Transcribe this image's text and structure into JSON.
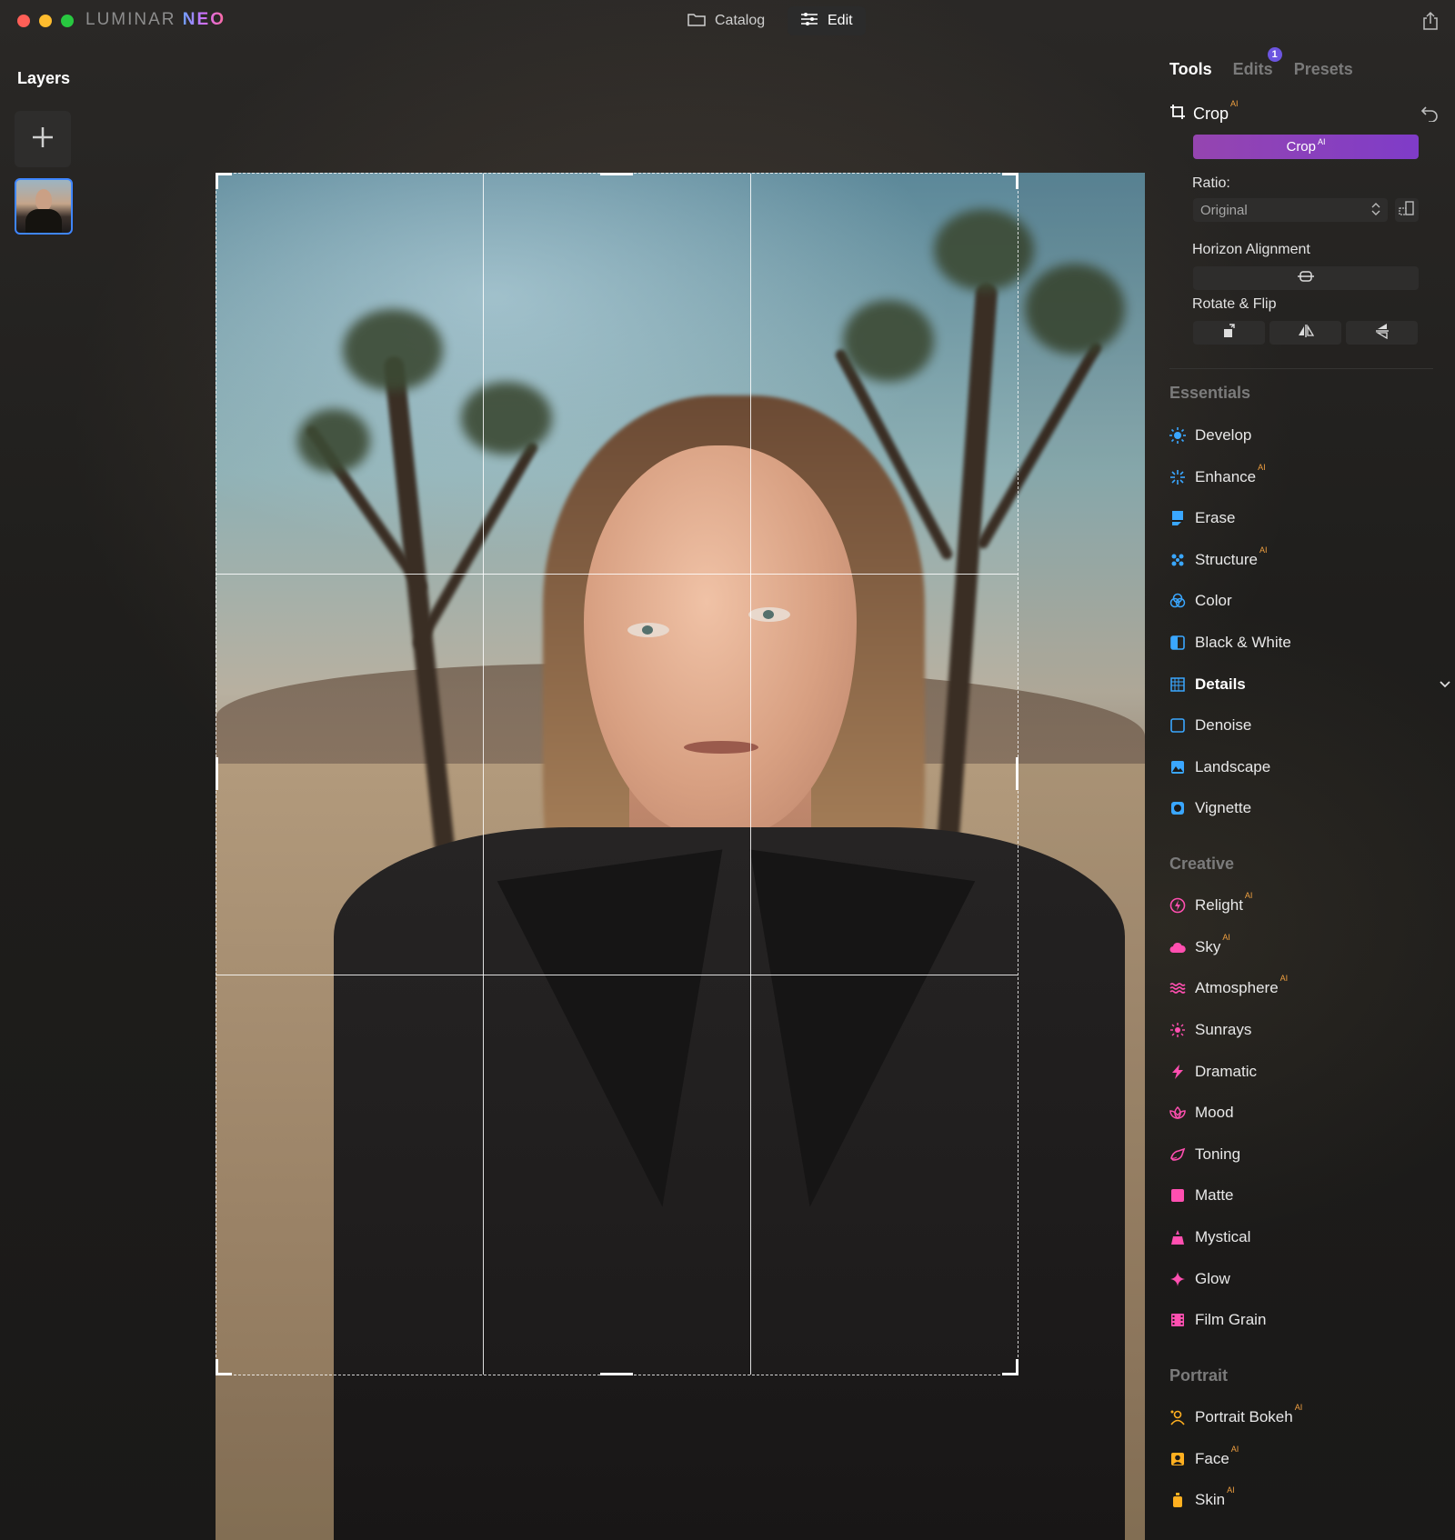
{
  "app": {
    "brand_part1": "LUMINAR",
    "brand_part2": "NEO"
  },
  "topbar": {
    "catalog_label": "Catalog",
    "edit_label": "Edit"
  },
  "layers": {
    "title": "Layers"
  },
  "right_panel": {
    "tabs": [
      {
        "label": "Tools",
        "active": true
      },
      {
        "label": "Edits",
        "badge": "1"
      },
      {
        "label": "Presets"
      }
    ],
    "crop": {
      "title": "Crop",
      "ai_tag": "AI",
      "button_label": "Crop",
      "ratio_label": "Ratio:",
      "ratio_value": "Original",
      "horizon_label": "Horizon Alignment",
      "rotate_label": "Rotate & Flip"
    },
    "sections": {
      "essentials": "Essentials",
      "creative": "Creative",
      "portrait": "Portrait"
    },
    "essentials": [
      {
        "label": "Develop",
        "icon": "sun-icon",
        "color": "#3aa7ff"
      },
      {
        "label": "Enhance",
        "ai": true,
        "icon": "sparkle-icon",
        "color": "#3aa7ff"
      },
      {
        "label": "Erase",
        "icon": "eraser-icon",
        "color": "#3aa7ff"
      },
      {
        "label": "Structure",
        "ai": true,
        "icon": "structure-icon",
        "color": "#3aa7ff"
      },
      {
        "label": "Color",
        "icon": "color-circles-icon",
        "color": "#3aa7ff"
      },
      {
        "label": "Black & White",
        "icon": "bw-square-icon",
        "color": "#3aa7ff"
      },
      {
        "label": "Details",
        "icon": "details-grid-icon",
        "color": "#3aa7ff",
        "expanded": true
      },
      {
        "label": "Denoise",
        "icon": "denoise-icon",
        "color": "#3aa7ff"
      },
      {
        "label": "Landscape",
        "icon": "landscape-icon",
        "color": "#3aa7ff"
      },
      {
        "label": "Vignette",
        "icon": "vignette-icon",
        "color": "#3aa7ff"
      }
    ],
    "creative": [
      {
        "label": "Relight",
        "ai": true,
        "icon": "relight-icon",
        "color": "#ff4fb0"
      },
      {
        "label": "Sky",
        "ai": true,
        "icon": "cloud-icon",
        "color": "#ff4fb0"
      },
      {
        "label": "Atmosphere",
        "ai": true,
        "icon": "waves-icon",
        "color": "#ff4fb0"
      },
      {
        "label": "Sunrays",
        "icon": "sunrays-icon",
        "color": "#ff4fb0"
      },
      {
        "label": "Dramatic",
        "icon": "lightning-icon",
        "color": "#ff4fb0"
      },
      {
        "label": "Mood",
        "icon": "lotus-icon",
        "color": "#ff4fb0"
      },
      {
        "label": "Toning",
        "icon": "brush-icon",
        "color": "#ff4fb0"
      },
      {
        "label": "Matte",
        "icon": "matte-square-icon",
        "color": "#ff4fb0"
      },
      {
        "label": "Mystical",
        "icon": "mystical-icon",
        "color": "#ff4fb0"
      },
      {
        "label": "Glow",
        "icon": "glow-star-icon",
        "color": "#ff4fb0"
      },
      {
        "label": "Film Grain",
        "icon": "film-icon",
        "color": "#ff4fb0"
      }
    ],
    "portrait": [
      {
        "label": "Portrait Bokeh",
        "ai": true,
        "icon": "portrait-bokeh-icon",
        "color": "#ffb020"
      },
      {
        "label": "Face",
        "ai": true,
        "icon": "face-icon",
        "color": "#ffb020"
      },
      {
        "label": "Skin",
        "ai": true,
        "icon": "skin-bottle-icon",
        "color": "#ffb020"
      }
    ]
  }
}
